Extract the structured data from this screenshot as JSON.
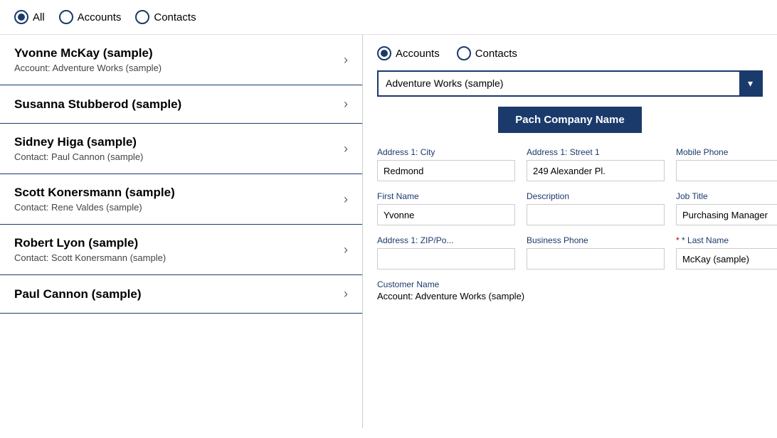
{
  "topBar": {
    "filters": [
      {
        "id": "all",
        "label": "All",
        "selected": true
      },
      {
        "id": "accounts",
        "label": "Accounts",
        "selected": false
      },
      {
        "id": "contacts",
        "label": "Contacts",
        "selected": false
      }
    ]
  },
  "leftPanel": {
    "contacts": [
      {
        "name": "Yvonne McKay (sample)",
        "sub": "Account: Adventure Works (sample)"
      },
      {
        "name": "Susanna Stubberod (sample)",
        "sub": ""
      },
      {
        "name": "Sidney Higa (sample)",
        "sub": "Contact: Paul Cannon (sample)"
      },
      {
        "name": "Scott Konersmann (sample)",
        "sub": "Contact: Rene Valdes (sample)"
      },
      {
        "name": "Robert Lyon (sample)",
        "sub": "Contact: Scott Konersmann (sample)"
      },
      {
        "name": "Paul Cannon (sample)",
        "sub": ""
      }
    ]
  },
  "rightPanel": {
    "radioFilters": [
      {
        "id": "accounts",
        "label": "Accounts",
        "selected": true
      },
      {
        "id": "contacts",
        "label": "Contacts",
        "selected": false
      }
    ],
    "dropdown": {
      "value": "Adventure Works (sample)",
      "chevron": "▾"
    },
    "patchButton": "Pach Company Name",
    "fields": [
      {
        "label": "Address 1: City",
        "value": "Redmond",
        "required": false
      },
      {
        "label": "Address 1: Street 1",
        "value": "249 Alexander Pl.",
        "required": false
      },
      {
        "label": "Mobile Phone",
        "value": "",
        "required": false
      },
      {
        "label": "First Name",
        "value": "Yvonne",
        "required": false
      },
      {
        "label": "Description",
        "value": "",
        "required": false
      },
      {
        "label": "Job Title",
        "value": "Purchasing Manager",
        "required": false
      },
      {
        "label": "Address 1: ZIP/Po...",
        "value": "",
        "required": false
      },
      {
        "label": "Business Phone",
        "value": "",
        "required": false
      },
      {
        "label": "Last Name",
        "value": "McKay (sample)",
        "required": true
      }
    ],
    "customerName": {
      "label": "Customer Name",
      "value": "Account: Adventure Works (sample)"
    }
  },
  "icons": {
    "chevronRight": "›"
  }
}
